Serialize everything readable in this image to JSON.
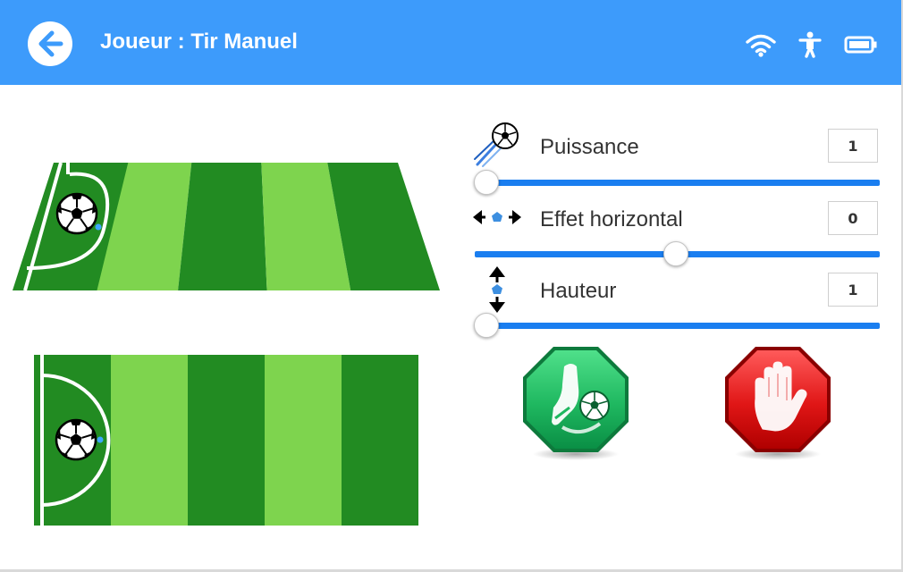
{
  "header": {
    "title": "Joueur : Tir Manuel",
    "back_icon": "arrow-left-icon",
    "status_icons": [
      "wifi-icon",
      "accessibility-icon",
      "battery-icon"
    ]
  },
  "fields": [
    {
      "name": "perspective-field",
      "view": "perspective"
    },
    {
      "name": "top-view-field",
      "view": "top"
    }
  ],
  "controls": [
    {
      "key": "puissance",
      "icon": "ball-kick-icon",
      "label": "Puissance",
      "value": "1",
      "level": 0.0
    },
    {
      "key": "effet",
      "icon": "horizontal-arrows-icon",
      "label": "Effet horizontal",
      "value": "0",
      "level": 0.5
    },
    {
      "key": "hauteur",
      "icon": "vertical-arrows-icon",
      "label": "Hauteur",
      "value": "1",
      "level": 0.0
    }
  ],
  "actions": {
    "shoot_icon": "kick-shoot-icon",
    "stop_icon": "stop-hand-icon"
  },
  "colors": {
    "header": "#3d9bfb",
    "slider": "#1a7ef0",
    "field_dark": "#228b22",
    "field_light": "#7ed44e",
    "shoot": "#1aa65a",
    "stop": "#d41414"
  }
}
